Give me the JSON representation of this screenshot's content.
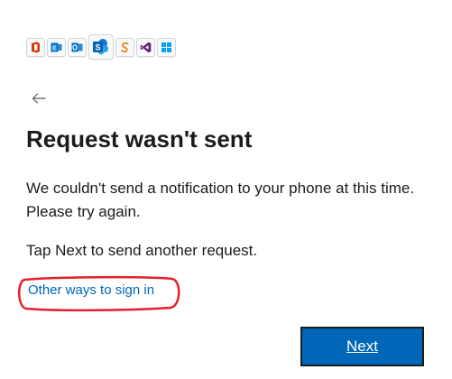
{
  "brand_logos": [
    {
      "name": "office-icon",
      "color": "#d83b01",
      "glyph": "O"
    },
    {
      "name": "exchange-icon",
      "color": "#0072c6",
      "glyph": "E"
    },
    {
      "name": "outlook-icon",
      "color": "#0072c6",
      "glyph": "O"
    },
    {
      "name": "sharepoint-icon",
      "color": "#0078d4",
      "glyph": "S"
    },
    {
      "name": "swirl-icon",
      "color": "#e8871e",
      "glyph": "S"
    },
    {
      "name": "visual-studio-icon",
      "color": "#68217a",
      "glyph": "VS"
    },
    {
      "name": "windows-icon",
      "color": "#00a4ef",
      "glyph": "W"
    }
  ],
  "back": {
    "icon": "back-arrow-icon"
  },
  "title": "Request wasn't sent",
  "message": "We couldn't send a notification to your phone at this time. Please try again.",
  "hint": "Tap Next to send another request.",
  "other_ways_link": "Other ways to sign in",
  "next_button": "Next",
  "colors": {
    "accent": "#0067b8",
    "highlight_ring": "#e3212b",
    "text": "#1b1b1b"
  }
}
